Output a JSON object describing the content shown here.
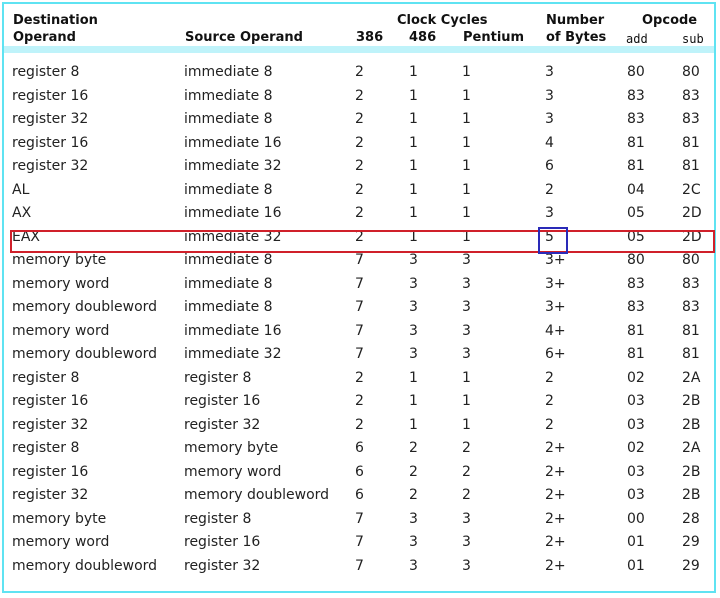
{
  "header": {
    "destination_line1": "Destination",
    "destination_line2": "Operand",
    "source": "Source Operand",
    "clock_cycles": "Clock Cycles",
    "c386": "386",
    "c486": "486",
    "pentium": "Pentium",
    "bytes_line1": "Number",
    "bytes_line2": "of Bytes",
    "opcode": "Opcode",
    "op_add": "add",
    "op_sub": "sub"
  },
  "rows": [
    [
      "register 8",
      "immediate 8",
      "2",
      "1",
      "1",
      "3",
      "80",
      "80"
    ],
    [
      "register 16",
      "immediate 8",
      "2",
      "1",
      "1",
      "3",
      "83",
      "83"
    ],
    [
      "register 32",
      "immediate 8",
      "2",
      "1",
      "1",
      "3",
      "83",
      "83"
    ],
    [
      "register 16",
      "immediate 16",
      "2",
      "1",
      "1",
      "4",
      "81",
      "81"
    ],
    [
      "register 32",
      "immediate 32",
      "2",
      "1",
      "1",
      "6",
      "81",
      "81"
    ],
    [
      "AL",
      "immediate 8",
      "2",
      "1",
      "1",
      "2",
      "04",
      "2C"
    ],
    [
      "AX",
      "immediate 16",
      "2",
      "1",
      "1",
      "3",
      "05",
      "2D"
    ],
    [
      "EAX",
      "immediate 32",
      "2",
      "1",
      "1",
      "5",
      "05",
      "2D"
    ],
    [
      "memory byte",
      "immediate 8",
      "7",
      "3",
      "3",
      "3+",
      "80",
      "80"
    ],
    [
      "memory word",
      "immediate 8",
      "7",
      "3",
      "3",
      "3+",
      "83",
      "83"
    ],
    [
      "memory doubleword",
      "immediate 8",
      "7",
      "3",
      "3",
      "3+",
      "83",
      "83"
    ],
    [
      "memory word",
      "immediate 16",
      "7",
      "3",
      "3",
      "4+",
      "81",
      "81"
    ],
    [
      "memory doubleword",
      "immediate 32",
      "7",
      "3",
      "3",
      "6+",
      "81",
      "81"
    ],
    [
      "register 8",
      "register 8",
      "2",
      "1",
      "1",
      "2",
      "02",
      "2A"
    ],
    [
      "register 16",
      "register 16",
      "2",
      "1",
      "1",
      "2",
      "03",
      "2B"
    ],
    [
      "register 32",
      "register 32",
      "2",
      "1",
      "1",
      "2",
      "03",
      "2B"
    ],
    [
      "register 8",
      "memory byte",
      "6",
      "2",
      "2",
      "2+",
      "02",
      "2A"
    ],
    [
      "register 16",
      "memory word",
      "6",
      "2",
      "2",
      "2+",
      "03",
      "2B"
    ],
    [
      "register 32",
      "memory doubleword",
      "6",
      "2",
      "2",
      "2+",
      "03",
      "2B"
    ],
    [
      "memory byte",
      "register 8",
      "7",
      "3",
      "3",
      "2+",
      "00",
      "28"
    ],
    [
      "memory word",
      "register 16",
      "7",
      "3",
      "3",
      "2+",
      "01",
      "29"
    ],
    [
      "memory doubleword",
      "register 32",
      "7",
      "3",
      "3",
      "2+",
      "01",
      "29"
    ]
  ],
  "colors": {
    "frame_border": "#5fe3f2",
    "header_bar": "#bff3fa",
    "row_highlight": "#d0202a",
    "cell_highlight": "#2a2ab8"
  }
}
